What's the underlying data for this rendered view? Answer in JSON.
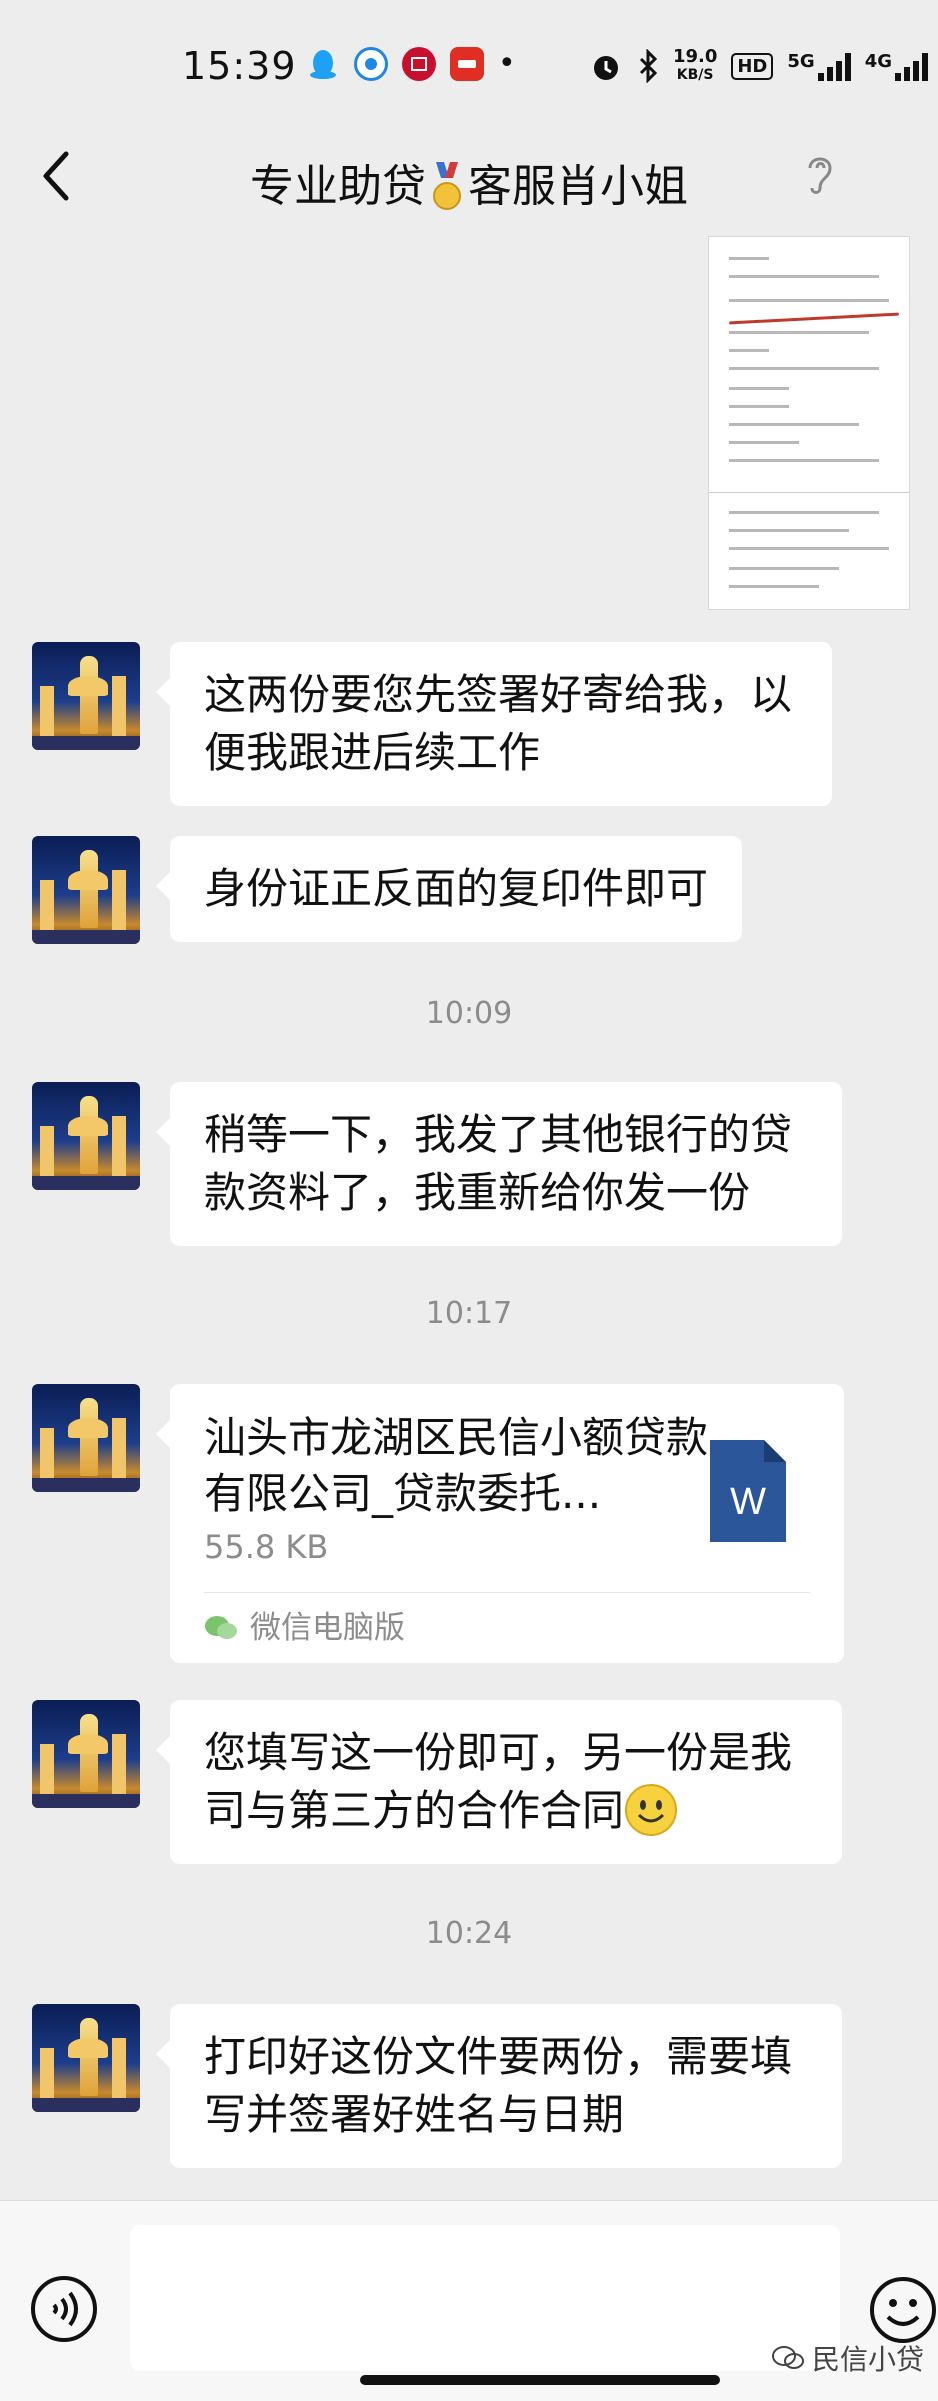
{
  "status_bar": {
    "time": "15:39",
    "net_speed_value": "19.0",
    "net_speed_unit": "KB/S",
    "hd_label": "HD",
    "sig1_label": "5G",
    "sig2_label": "4G"
  },
  "header": {
    "title_part1": "专业助贷",
    "title_part2": "客服肖小姐"
  },
  "messages": [
    {
      "type": "text",
      "text": "这两份要您先签署好寄给我，以便我跟进后续工作"
    },
    {
      "type": "text",
      "text": "身份证正反面的复印件即可"
    },
    {
      "type": "timestamp",
      "text": "10:09"
    },
    {
      "type": "text",
      "text": "稍等一下，我发了其他银行的贷款资料了，我重新给你发一份"
    },
    {
      "type": "timestamp",
      "text": "10:17"
    },
    {
      "type": "file",
      "name": "汕头市龙湖区民信小额贷款有限公司_贷款委托...",
      "size": "55.8 KB",
      "source": "微信电脑版",
      "icon_letter": "W"
    },
    {
      "type": "text",
      "text": "您填写这一份即可，另一份是我司与第三方的合作合同"
    },
    {
      "type": "timestamp",
      "text": "10:24"
    },
    {
      "type": "text",
      "text": "打印好这份文件要两份，需要填写并签署好姓名与日期"
    }
  ],
  "watermark": "民信小贷",
  "colors": {
    "background": "#ededed",
    "bubble": "#ffffff",
    "word_blue": "#2b579a",
    "timestamp": "#8c8c8c"
  }
}
